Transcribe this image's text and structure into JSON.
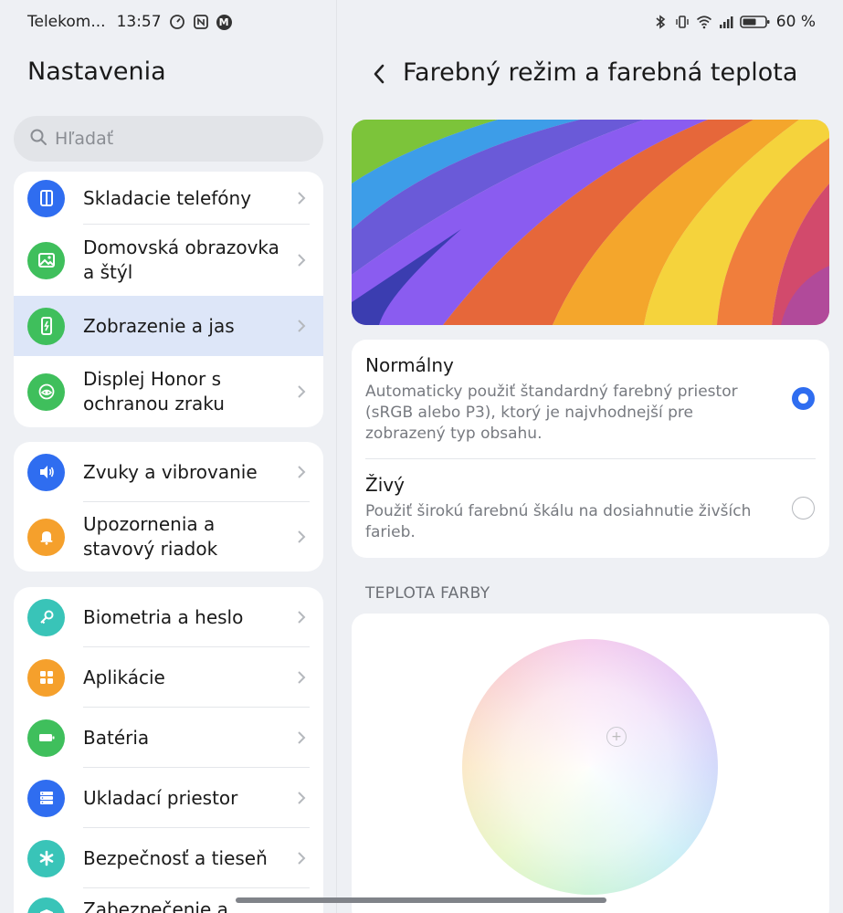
{
  "status_bar": {
    "carrier": "Telekom...",
    "time": "13:57",
    "battery": "60 %",
    "left_icons": [
      "timer-icon",
      "nfc-icon",
      "m-badge-icon"
    ],
    "right_icons": [
      "bluetooth-icon",
      "vibrate-icon",
      "wifi-icon",
      "signal-icon",
      "battery-icon"
    ]
  },
  "sidebar": {
    "title": "Nastavenia",
    "search_placeholder": "Hľadať",
    "groups": [
      [
        {
          "label": "Skladacie telefóny",
          "icon": "foldable-icon",
          "color": "#2f6df0"
        },
        {
          "label": "Domovská obrazovka a štýl",
          "icon": "image-icon",
          "color": "#3fbf5c"
        },
        {
          "label": "Zobrazenie a jas",
          "icon": "display-icon",
          "color": "#3fbf5c",
          "selected": true
        },
        {
          "label": "Displej Honor s ochranou zraku",
          "icon": "eye-comfort-icon",
          "color": "#3fbf5c"
        }
      ],
      [
        {
          "label": "Zvuky a vibrovanie",
          "icon": "speaker-icon",
          "color": "#2f6df0"
        },
        {
          "label": "Upozornenia a stavový riadok",
          "icon": "bell-icon",
          "color": "#f5a02c"
        }
      ],
      [
        {
          "label": "Biometria a heslo",
          "icon": "key-icon",
          "color": "#39c4b8"
        },
        {
          "label": "Aplikácie",
          "icon": "apps-icon",
          "color": "#f5a02c"
        },
        {
          "label": "Batéria",
          "icon": "battery-icon",
          "color": "#3fbf5c"
        },
        {
          "label": "Ukladací priestor",
          "icon": "storage-icon",
          "color": "#2f6df0"
        },
        {
          "label": "Bezpečnosť a tieseň",
          "icon": "asterisk-icon",
          "color": "#39c4b8"
        },
        {
          "label": "Zabezpečenie a",
          "icon": "shield-icon",
          "color": "#39c4b8"
        }
      ]
    ]
  },
  "detail": {
    "title": "Farebný režim a farebná teplota",
    "modes": [
      {
        "title": "Normálny",
        "description": "Automaticky použiť štandardný farebný priestor (sRGB alebo P3), ktorý je najvhodnejší pre zobrazený typ obsahu.",
        "selected": true
      },
      {
        "title": "Živý",
        "description": "Použiť širokú farebnú škálu na dosiahnutie živších farieb.",
        "selected": false
      }
    ],
    "temperature_header": "TEPLOTA FARBY"
  },
  "colors": {
    "accent": "#2f6df0",
    "selected_bg": "#dde6f8"
  }
}
